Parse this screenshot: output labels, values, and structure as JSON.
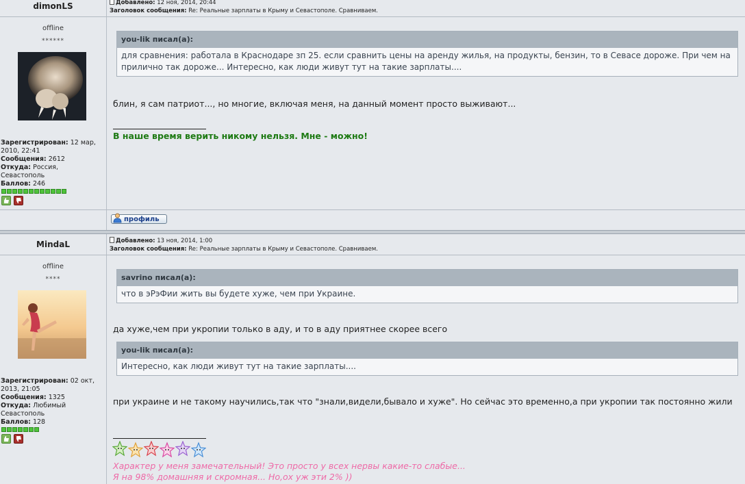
{
  "posts": [
    {
      "author": "dimonLS",
      "status": "offline",
      "rank_stars": "******",
      "added_label": "Добавлено:",
      "added_value": "12 ноя, 2014, 20:44",
      "subject_label": "Заголовок сообщения:",
      "subject_value": "Re: Реальные зарплаты в Крыму и Севастополе. Сравниваем.",
      "registered_label": "Зарегистрирован:",
      "registered_value": "12 мар, 2010, 22:41",
      "messages_label": "Сообщения:",
      "messages_value": "2612",
      "from_label": "Откуда:",
      "from_value": "Россия, Севастополь",
      "points_label": "Баллов:",
      "points_value": "246",
      "quote_author": "you-lik писал(а):",
      "quote_text": "для сравнения: работала в Краснодаре зп 25. если сравнить цены на аренду жилья, на продукты, бензин, то в Севасе дороже. При чем на прилично так дороже... Интересно, как люди живут тут на такие зарплаты....",
      "body_text": "блин, я сам патриот..., но многие, включая меня, на данный момент просто выживают...",
      "signature": "В наше время верить никому нельзя. Мне - можно!",
      "profile_button": "профиль"
    },
    {
      "author": "MindaL",
      "status": "offline",
      "rank_stars": "****",
      "added_label": "Добавлено:",
      "added_value": "13 ноя, 2014, 1:00",
      "subject_label": "Заголовок сообщения:",
      "subject_value": "Re: Реальные зарплаты в Крыму и Севастополе. Сравниваем.",
      "registered_label": "Зарегистрирован:",
      "registered_value": "02 окт, 2013, 21:05",
      "messages_label": "Сообщения:",
      "messages_value": "1325",
      "from_label": "Откуда:",
      "from_value": "Любимый Севастополь",
      "points_label": "Баллов:",
      "points_value": "128",
      "quote1_author": "savrino писал(а):",
      "quote1_text": "что в эРэФии жить вы будете хуже, чем при Украине.",
      "body_text1": "да хуже,чем при укропии только в аду, и то в аду приятнее скорее всего",
      "quote2_author": "you-lik писал(а):",
      "quote2_text": "Интересно, как люди живут тут на такие зарплаты....",
      "body_text2": "при украине и не такому научились,так что \"знали,видели,бывало и хуже\". Но сейчас это временно,а при укропии так постоянно жили",
      "signature_line1": "Характер у меня замечательный! Это просто у всех нервы какие-то слабые...",
      "signature_line2": "Я на 98% домашняя и скромная... Но,ох уж эти 2% ))"
    }
  ],
  "colors": {
    "signature_green": "#1d7a13",
    "signature_pink": "#ee6aa7",
    "quote_header": "#aab4bd",
    "reputation_green": "#4fc33b"
  }
}
